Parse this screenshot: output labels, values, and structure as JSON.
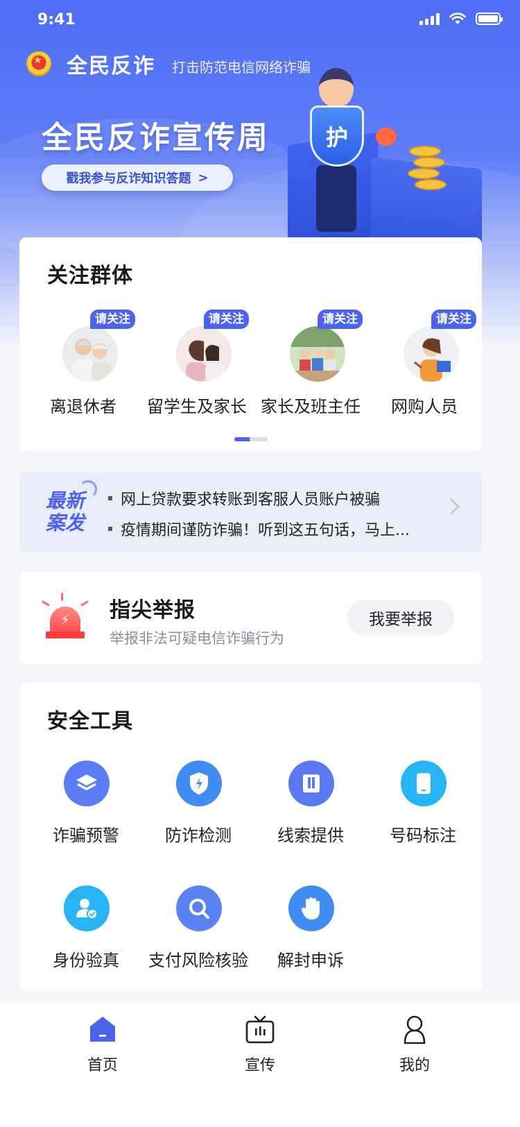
{
  "status_bar": {
    "time": "9:41"
  },
  "header": {
    "app_name": "全民反诈",
    "slogan": "打击防范电信网络诈骗",
    "banner_title": "全民反诈宣传周",
    "quiz_button": "戳我参与反诈知识答题",
    "quiz_arrow": ">",
    "shield_text": "护"
  },
  "groups": {
    "title": "关注群体",
    "badge": "请关注",
    "items": [
      {
        "label": "离退休者",
        "icon": "elderly-couple-avatar"
      },
      {
        "label": "留学生及家长",
        "icon": "mother-daughter-avatar"
      },
      {
        "label": "家长及班主任",
        "icon": "classroom-avatar"
      },
      {
        "label": "网购人员",
        "icon": "online-shopper-avatar"
      }
    ]
  },
  "news": {
    "tag_line1": "最新",
    "tag_line2": "案发",
    "items": [
      "网上贷款要求转账到客服人员账户被骗",
      "疫情期间谨防诈骗！听到这五句话，马上..."
    ]
  },
  "report": {
    "title": "指尖举报",
    "subtitle": "举报非法可疑电信诈骗行为",
    "button": "我要举报"
  },
  "tools": {
    "title": "安全工具",
    "items": [
      {
        "label": "诈骗预警",
        "icon": "layers-icon",
        "color": "#5c7cf6"
      },
      {
        "label": "防诈检测",
        "icon": "shield-bolt-icon",
        "color": "#3f8cf3"
      },
      {
        "label": "线索提供",
        "icon": "book-icon",
        "color": "#5a78f2"
      },
      {
        "label": "号码标注",
        "icon": "phone-icon",
        "color": "#27b4f5"
      },
      {
        "label": "身份验真",
        "icon": "user-check-icon",
        "color": "#27b4f5"
      },
      {
        "label": "支付风险核验",
        "icon": "search-icon",
        "color": "#5a82f3"
      },
      {
        "label": "解封申诉",
        "icon": "hand-icon",
        "color": "#3f8cf3"
      }
    ]
  },
  "tab_bar": {
    "items": [
      {
        "label": "首页",
        "icon": "home-icon",
        "active": true
      },
      {
        "label": "宣传",
        "icon": "tv-icon",
        "active": false
      },
      {
        "label": "我的",
        "icon": "profile-icon",
        "active": false
      }
    ]
  },
  "colors": {
    "primary": "#4c63ee",
    "alert": "#ff4d4d",
    "background": "#f4f6fb"
  }
}
